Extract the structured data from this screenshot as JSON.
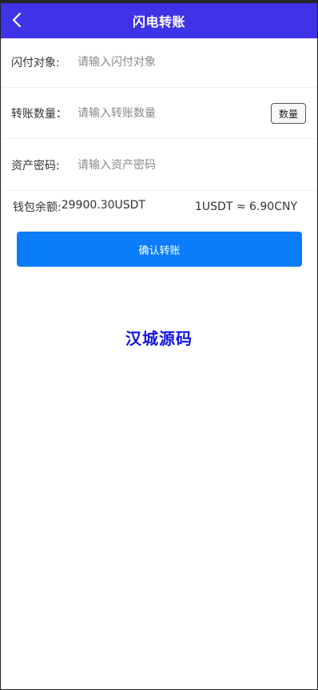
{
  "header": {
    "title": "闪电转账",
    "back_icon": "chevron-left-icon"
  },
  "form": {
    "target": {
      "label": "闪付对象:",
      "placeholder": "请输入闪付对象",
      "value": ""
    },
    "amount": {
      "label": "转账数量：",
      "placeholder": "请输入转账数量",
      "value": "",
      "qty_button": "数量"
    },
    "password": {
      "label": "资产密码:",
      "placeholder": "请输入资产密码",
      "value": ""
    }
  },
  "wallet": {
    "balance_label": "钱包余额:",
    "balance_value": "29900.30USDT",
    "rate": "1USDT ≈ 6.90CNY"
  },
  "confirm_label": "确认转账",
  "watermark": "汉城源码",
  "colors": {
    "header_bg": "#3e33e6",
    "button_bg": "#0b7dfb",
    "watermark": "#1414e6"
  }
}
